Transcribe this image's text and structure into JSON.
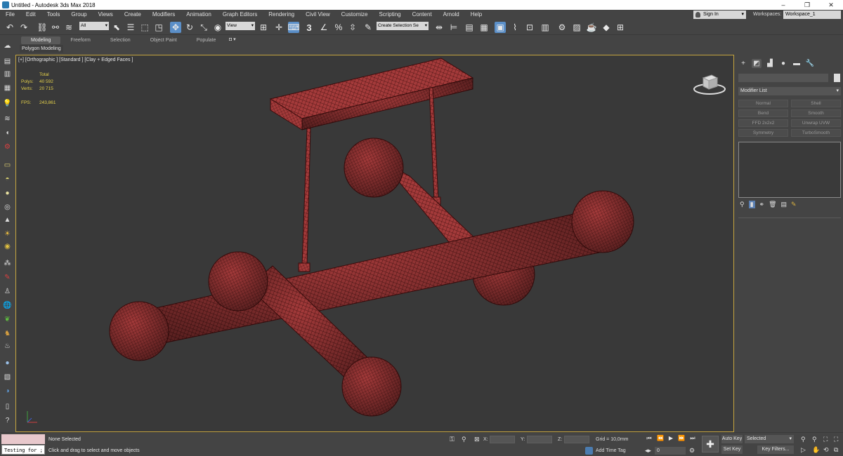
{
  "window": {
    "title": "Untitled - Autodesk 3ds Max 2018",
    "controls": [
      "–",
      "❐",
      "✕"
    ]
  },
  "menu": [
    "File",
    "Edit",
    "Tools",
    "Group",
    "Views",
    "Create",
    "Modifiers",
    "Animation",
    "Graph Editors",
    "Rendering",
    "Civil View",
    "Customize",
    "Scripting",
    "Content",
    "Arnold",
    "Help"
  ],
  "account": {
    "signin_label": "Sign In",
    "workspaces_label": "Workspaces:",
    "workspace_value": "Workspace_1"
  },
  "toolbar": {
    "selection_filter": "All",
    "ref_coord": "View",
    "named_selection": "Create Selection Se",
    "snap_label": "3",
    "icons": [
      "undo-icon",
      "redo-icon",
      "link-icon",
      "unlink-icon",
      "bind-spacewarp-icon",
      "select-object-icon",
      "select-by-name-icon",
      "rect-region-icon",
      "window-crossing-icon",
      "select-move-icon",
      "select-rotate-icon",
      "select-scale-icon",
      "place-icon",
      "select-manipulate-icon",
      "keyboard-shortcut-icon",
      "snaps-toggle-icon",
      "angle-snap-icon",
      "percent-snap-icon",
      "spinner-snap-icon",
      "edit-named-sel-icon",
      "mirror-icon",
      "align-icon",
      "toggle-scene-explorer-icon",
      "toggle-layer-explorer-icon",
      "ribbon-toggle-icon",
      "curve-editor-icon",
      "schematic-view-icon",
      "material-editor-icon",
      "render-setup-icon",
      "rendered-frame-icon",
      "render-production-icon",
      "render-iterative-icon",
      "a360-icon"
    ]
  },
  "ribbon": {
    "tabs": [
      "Modeling",
      "Freeform",
      "Selection",
      "Object Paint",
      "Populate"
    ],
    "active_tab": "Modeling",
    "sub_label": "Polygon Modeling",
    "pin_label": "◘ ▾"
  },
  "viewport": {
    "label": "[+] [Orthographic ] [Standard ] [Clay + Edged Faces ]",
    "stats": {
      "header": "Total",
      "polys_label": "Polys:",
      "polys_value": "40 592",
      "verts_label": "Verts:",
      "verts_value": "20 715",
      "fps_label": "FPS:",
      "fps_value": "243,861"
    },
    "object_color": "#a33a3a",
    "wire_color": "#3a0c0c"
  },
  "command_panel": {
    "tabs": [
      "create-tab",
      "modify-tab",
      "hierarchy-tab",
      "motion-tab",
      "display-tab",
      "utilities-tab"
    ],
    "modifier_list_label": "Modifier List",
    "modifier_buttons": [
      "Normal",
      "Shell",
      "Bend",
      "Smooth",
      "FFD 2x2x2",
      "Unwrap UVW",
      "Symmetry",
      "TurboSmooth"
    ]
  },
  "status": {
    "maxscript_value": "Testing for ;",
    "selection_text": "None Selected",
    "prompt_text": "Click and drag to select and move objects",
    "x_label": "X:",
    "y_label": "Y:",
    "z_label": "Z:",
    "grid_text": "Grid = 10,0mm",
    "add_time_tag": "Add Time Tag",
    "frame_value": "0",
    "auto_key": "Auto Key",
    "set_key": "Set Key",
    "key_mode_value": "Selected",
    "key_filters": "Key Filters..."
  }
}
